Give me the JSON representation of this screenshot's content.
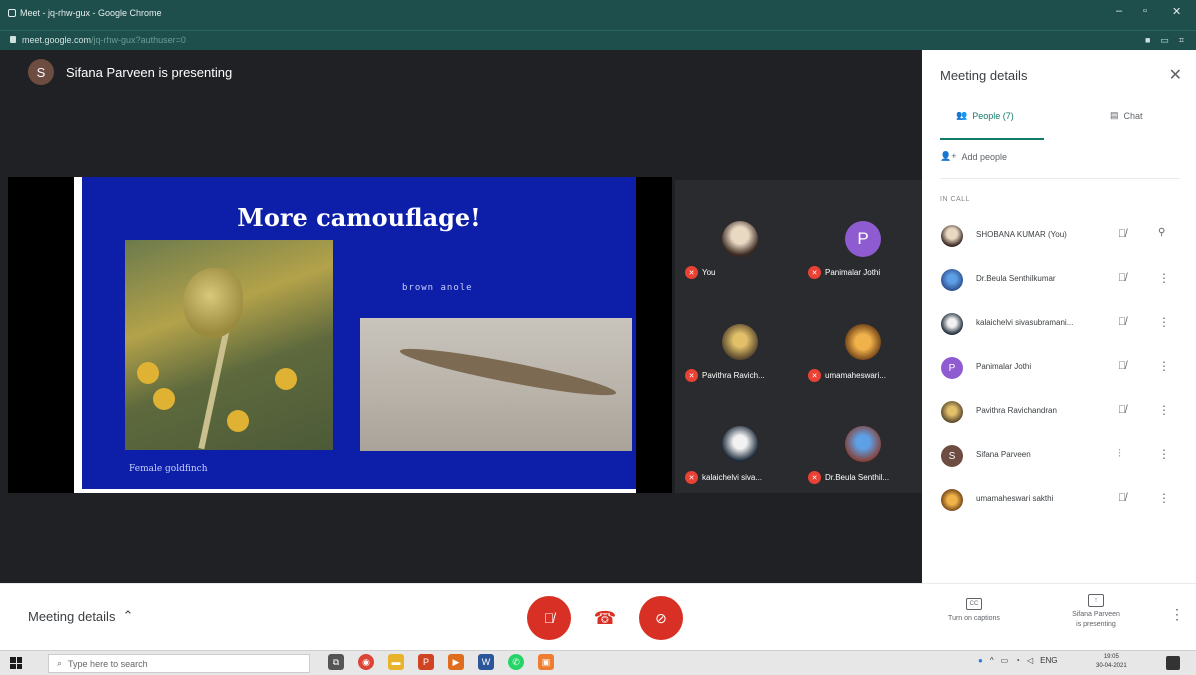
{
  "browser": {
    "title": "Meet - jq-rhw-gux - Google Chrome",
    "url_host": "meet.google.com",
    "url_path": "/jq-rhw-gux?authuser=0"
  },
  "stage": {
    "presenter_initial": "S",
    "presenter_text": "Sifana Parveen is presenting",
    "slide": {
      "title": "More camouflage!",
      "caption_anole": "brown anole",
      "caption_finch": "Female goldfinch"
    }
  },
  "tiles": [
    {
      "name": "You",
      "initial": ""
    },
    {
      "name": "Panimalar Jothi",
      "initial": "P"
    },
    {
      "name": "Pavithra Ravich...",
      "initial": ""
    },
    {
      "name": "umamaheswari...",
      "initial": ""
    },
    {
      "name": "kalaichelvi siva...",
      "initial": ""
    },
    {
      "name": "Dr.Beula Senthil...",
      "initial": ""
    }
  ],
  "panel": {
    "title": "Meeting details",
    "close": "✕",
    "tab_people": "People (7)",
    "tab_chat": "Chat",
    "add_people": "Add people",
    "in_call": "IN CALL",
    "people": [
      {
        "name": "SHOBANA KUMAR (You)",
        "initial": ""
      },
      {
        "name": "Dr.Beula Senthilkumar",
        "initial": ""
      },
      {
        "name": "kalaichelvi sivasubramani...",
        "initial": ""
      },
      {
        "name": "Panimalar Jothi",
        "initial": "P"
      },
      {
        "name": "Pavithra Ravichandran",
        "initial": ""
      },
      {
        "name": "Sifana Parveen",
        "initial": "S"
      },
      {
        "name": "umamaheswari sakthi",
        "initial": ""
      }
    ]
  },
  "controls": {
    "meeting_details": "Meeting details",
    "captions_label": "Turn on captions",
    "captions_icon": "CC",
    "presenting_line1": "Sifana Parveen",
    "presenting_line2": "is presenting"
  },
  "taskbar": {
    "search_placeholder": "Type here to search",
    "lang": "ENG",
    "time": "19:05",
    "date": "30-04-2021"
  }
}
